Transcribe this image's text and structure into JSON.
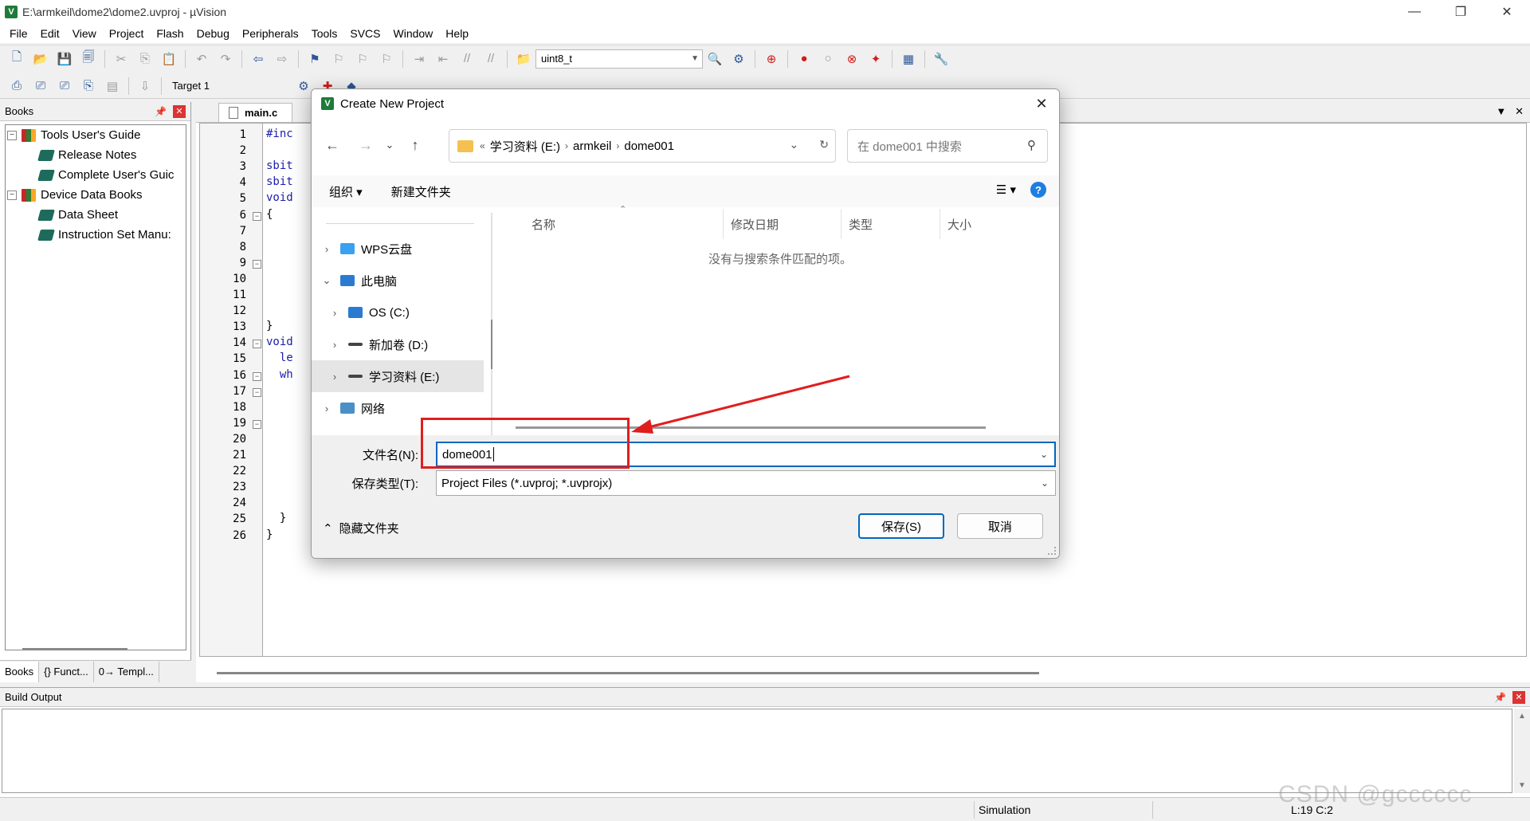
{
  "window": {
    "title": "E:\\armkeil\\dome2\\dome2.uvproj - µVision",
    "controls": {
      "minimize": "—",
      "restore": "❐",
      "close": "✕"
    }
  },
  "menu": [
    "File",
    "Edit",
    "View",
    "Project",
    "Flash",
    "Debug",
    "Peripherals",
    "Tools",
    "SVCS",
    "Window",
    "Help"
  ],
  "toolbar": {
    "find_combo": "uint8_t",
    "target": "Target 1"
  },
  "books_panel": {
    "title": "Books",
    "tree": [
      {
        "label": "Tools User's Guide",
        "level": 1,
        "expander": "−"
      },
      {
        "label": "Release Notes",
        "level": 2
      },
      {
        "label": "Complete User's Guic",
        "level": 2
      },
      {
        "label": "Device Data Books",
        "level": 1,
        "expander": "−"
      },
      {
        "label": "Data Sheet",
        "level": 2
      },
      {
        "label": "Instruction Set Manu:",
        "level": 2
      }
    ],
    "tabs": [
      "Books",
      "{} Funct...",
      "0→ Templ..."
    ]
  },
  "editor": {
    "tab": "main.c",
    "lines": [
      {
        "n": "1",
        "code": "#inc"
      },
      {
        "n": "2",
        "code": ""
      },
      {
        "n": "3",
        "code": "sbit"
      },
      {
        "n": "4",
        "code": "sbit"
      },
      {
        "n": "5",
        "code": "void"
      },
      {
        "n": "6",
        "code": "{",
        "fold": "−"
      },
      {
        "n": "7",
        "code": ""
      },
      {
        "n": "8",
        "code": ""
      },
      {
        "n": "9",
        "code": "",
        "fold": "−"
      },
      {
        "n": "10",
        "code": ""
      },
      {
        "n": "11",
        "code": ""
      },
      {
        "n": "12",
        "code": ""
      },
      {
        "n": "13",
        "code": "}"
      },
      {
        "n": "14",
        "code": "void",
        "fold": "−"
      },
      {
        "n": "15",
        "code": "  le"
      },
      {
        "n": "16",
        "code": "  wh",
        "fold": "−"
      },
      {
        "n": "17",
        "code": "",
        "fold": "−"
      },
      {
        "n": "18",
        "code": ""
      },
      {
        "n": "19",
        "code": "",
        "fold": "−"
      },
      {
        "n": "20",
        "code": ""
      },
      {
        "n": "21",
        "code": ""
      },
      {
        "n": "22",
        "code": ""
      },
      {
        "n": "23",
        "code": ""
      },
      {
        "n": "24",
        "code": ""
      },
      {
        "n": "25",
        "code": "  }"
      },
      {
        "n": "26",
        "code": "}"
      }
    ]
  },
  "build_output": {
    "title": "Build Output"
  },
  "status": {
    "mode": "Simulation",
    "position": "L:19 C:2",
    "watermark": "CSDN @gcccccc"
  },
  "dialog": {
    "title": "Create New Project",
    "address": {
      "prefix": "«",
      "crumbs": [
        "学习资料 (E:)",
        "armkeil",
        "dome001"
      ]
    },
    "search_placeholder": "在 dome001 中搜索",
    "commands": {
      "organize": "组织 ▾",
      "new_folder": "新建文件夹"
    },
    "nav_items": [
      {
        "label": "WPS云盘",
        "chevron": "›",
        "indent": 0
      },
      {
        "label": "此电脑",
        "chevron": "⌄",
        "indent": 0
      },
      {
        "label": "OS (C:)",
        "chevron": "›",
        "indent": 1
      },
      {
        "label": "新加卷 (D:)",
        "chevron": "›",
        "indent": 1
      },
      {
        "label": "学习资料 (E:)",
        "chevron": "›",
        "indent": 1,
        "selected": true
      },
      {
        "label": "网络",
        "chevron": "›",
        "indent": 0
      }
    ],
    "columns": [
      "名称",
      "修改日期",
      "类型",
      "大小"
    ],
    "empty_message": "没有与搜索条件匹配的项。",
    "filename_label": "文件名(N):",
    "filename_value": "dome001",
    "filetype_label": "保存类型(T):",
    "filetype_value": "Project Files (*.uvproj; *.uvprojx)",
    "hide_folders": "隐藏文件夹",
    "save_button": "保存(S)",
    "cancel_button": "取消"
  },
  "colors": {
    "accent": "#0067c0",
    "annotation": "#e01e1e",
    "keil_green": "#1e7b3a"
  }
}
